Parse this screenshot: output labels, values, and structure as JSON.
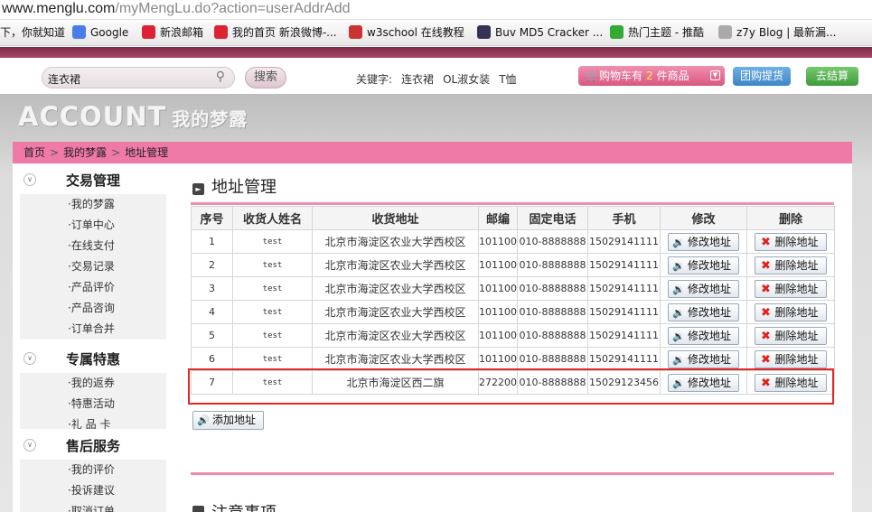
{
  "browser": {
    "url_domain": "www.menglu.com",
    "url_path": "/myMengLu.do?action=userAddrAdd"
  },
  "bookmarks": [
    {
      "label": "下，你就知道",
      "icon": "baidu-icon",
      "color": "#e33"
    },
    {
      "label": "Google",
      "icon": "google-icon",
      "color": "#4a7de8"
    },
    {
      "label": "新浪邮箱",
      "icon": "sina-icon",
      "color": "#d23"
    },
    {
      "label": "我的首页 新浪微博-...",
      "icon": "weibo-icon",
      "color": "#d23"
    },
    {
      "label": "w3school 在线教程",
      "icon": "w3school-icon",
      "color": "#c33"
    },
    {
      "label": "Buv MD5 Cracker ...",
      "icon": "md5-icon",
      "color": "#335"
    },
    {
      "label": "热门主题 - 推酷",
      "icon": "tuicool-icon",
      "color": "#3a3"
    },
    {
      "label": "z7y Blog | 最新漏...",
      "icon": "blog-icon",
      "color": "#aaa"
    }
  ],
  "search": {
    "value": "连衣裙",
    "button": "搜索",
    "keywords_label": "关键字:",
    "keywords": [
      "连衣裙",
      "OL淑女装",
      "T恤"
    ]
  },
  "header": {
    "cart_prefix": "购物车有",
    "cart_count": "2",
    "cart_suffix": "件商品",
    "group_buy": "团购提货",
    "checkout": "去结算"
  },
  "banner": {
    "title": "ACCOUNT",
    "subtitle": "我的梦露"
  },
  "breadcrumb": [
    "首页",
    "我的梦露",
    "地址管理"
  ],
  "sidebar": [
    {
      "title": "交易管理",
      "items": [
        "·我的梦露",
        "·订单中心",
        "·在线支付",
        "·交易记录",
        "·产品评价",
        "·产品咨询",
        "·订单合并"
      ]
    },
    {
      "title": "专属特惠",
      "items": [
        "·我的返券",
        "·特惠活动",
        "·礼 品 卡"
      ]
    },
    {
      "title": "售后服务",
      "items": [
        "·我的评价",
        "·投诉建议",
        "·取消订单"
      ]
    }
  ],
  "main": {
    "title": "地址管理",
    "columns": [
      "序号",
      "收货人姓名",
      "收货地址",
      "邮编",
      "固定电话",
      "手机",
      "修改",
      "删除"
    ],
    "edit_label": "修改地址",
    "delete_label": "删除地址",
    "rows": [
      {
        "no": "1",
        "name": "test",
        "addr": "北京市海淀区农业大学西校区",
        "zip": "101100",
        "tel": "010-8888888",
        "mobile": "15029141111"
      },
      {
        "no": "2",
        "name": "test",
        "addr": "北京市海淀区农业大学西校区",
        "zip": "101100",
        "tel": "010-8888888",
        "mobile": "15029141111"
      },
      {
        "no": "3",
        "name": "test",
        "addr": "北京市海淀区农业大学西校区",
        "zip": "101100",
        "tel": "010-8888888",
        "mobile": "15029141111"
      },
      {
        "no": "4",
        "name": "test",
        "addr": "北京市海淀区农业大学西校区",
        "zip": "101100",
        "tel": "010-8888888",
        "mobile": "15029141111"
      },
      {
        "no": "5",
        "name": "test",
        "addr": "北京市海淀区农业大学西校区",
        "zip": "101100",
        "tel": "010-8888888",
        "mobile": "15029141111"
      },
      {
        "no": "6",
        "name": "test",
        "addr": "北京市海淀区农业大学西校区",
        "zip": "101100",
        "tel": "010-8888888",
        "mobile": "15029141111"
      },
      {
        "no": "7",
        "name": "test",
        "addr": "北京市海淀区西二旗",
        "zip": "272200",
        "tel": "010-8888888",
        "mobile": "15029123456"
      }
    ],
    "add_label": "添加地址",
    "notice_title": "注意事项"
  }
}
